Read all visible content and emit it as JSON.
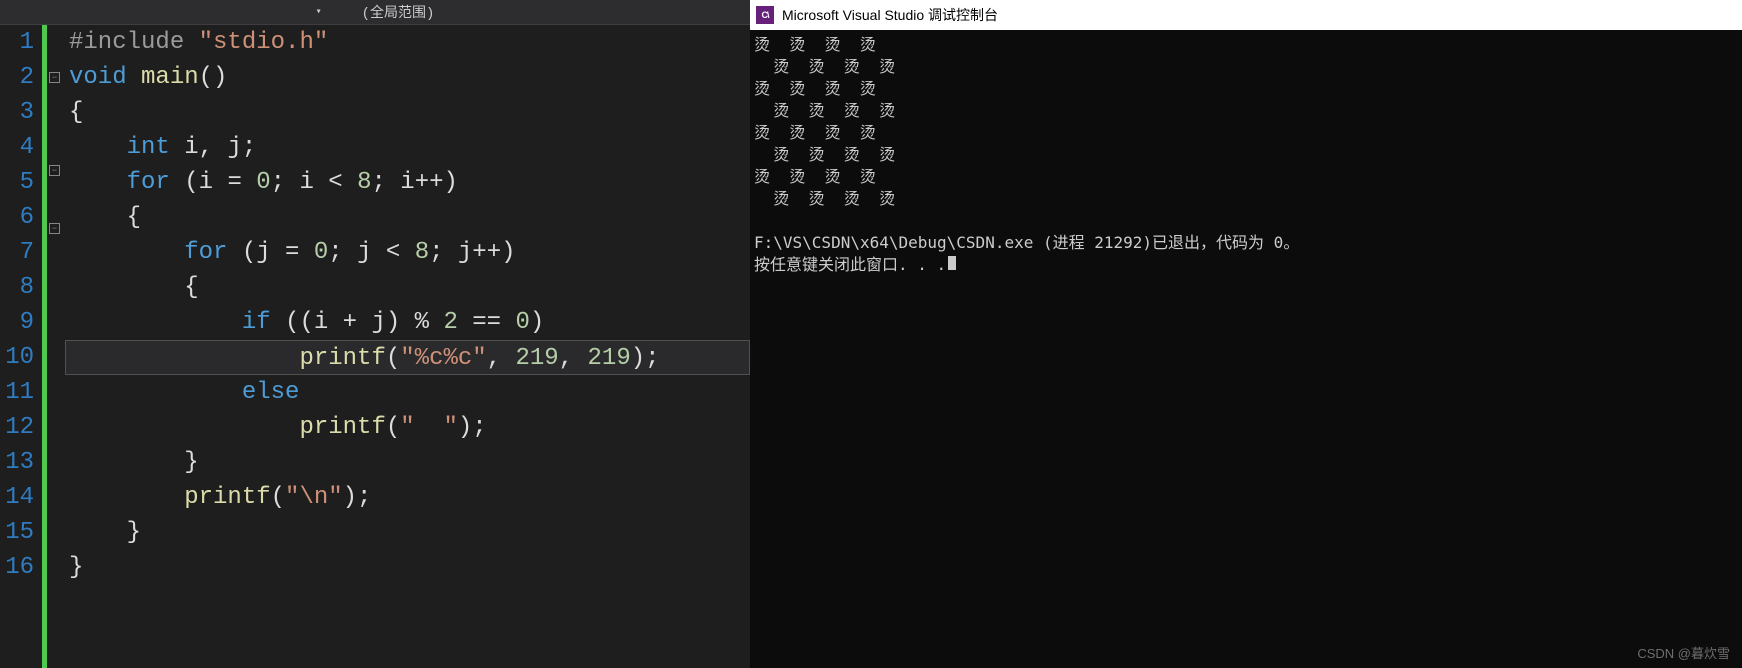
{
  "topbar": {
    "scope": "(全局范围)"
  },
  "lines": {
    "1": "1",
    "2": "2",
    "3": "3",
    "4": "4",
    "5": "5",
    "6": "6",
    "7": "7",
    "8": "8",
    "9": "9",
    "10": "10",
    "11": "11",
    "12": "12",
    "13": "13",
    "14": "14",
    "15": "15",
    "16": "16"
  },
  "code": {
    "pp": "#include",
    "incfile": "\"stdio.h\"",
    "void": "void",
    "main": "main",
    "parens": "()",
    "lb": "{",
    "rb": "}",
    "int": "int",
    "vars": " i, j;",
    "for": "for",
    "for1a": " (i = ",
    "z1": "0",
    "for1b": "; i < ",
    "e1": "8",
    "for1c": "; i++)",
    "for2a": " (j = ",
    "z2": "0",
    "for2b": "; j < ",
    "e2": "8",
    "for2c": "; j++)",
    "if": "if",
    "ifcond_a": " ((i + j) % ",
    "two": "2",
    "ifcond_b": " == ",
    "z3": "0",
    "ifcond_c": ")",
    "printf": "printf",
    "p1a": "(",
    "p1s": "\"%c%c\"",
    "p1b": ", ",
    "n219a": "219",
    "p1c": ", ",
    "n219b": "219",
    "p1d": ");",
    "else": "else",
    "p2a": "(",
    "p2s": "\"  \"",
    "p2b": ");",
    "p3a": "(",
    "p3s": "\"\\n\"",
    "p3b": ");"
  },
  "console": {
    "title": "Microsoft Visual Studio 调试控制台",
    "icon": "C\\",
    "l1": "烫  烫  烫  烫",
    "l2": "  烫  烫  烫  烫",
    "l3": "烫  烫  烫  烫",
    "l4": "  烫  烫  烫  烫",
    "l5": "烫  烫  烫  烫",
    "l6": "  烫  烫  烫  烫",
    "l7": "烫  烫  烫  烫",
    "l8": "  烫  烫  烫  烫",
    "blank": "",
    "exit": "F:\\VS\\CSDN\\x64\\Debug\\CSDN.exe (进程 21292)已退出，代码为 0。",
    "press": "按任意键关闭此窗口. . ."
  },
  "watermark": "CSDN @暮炊雪"
}
